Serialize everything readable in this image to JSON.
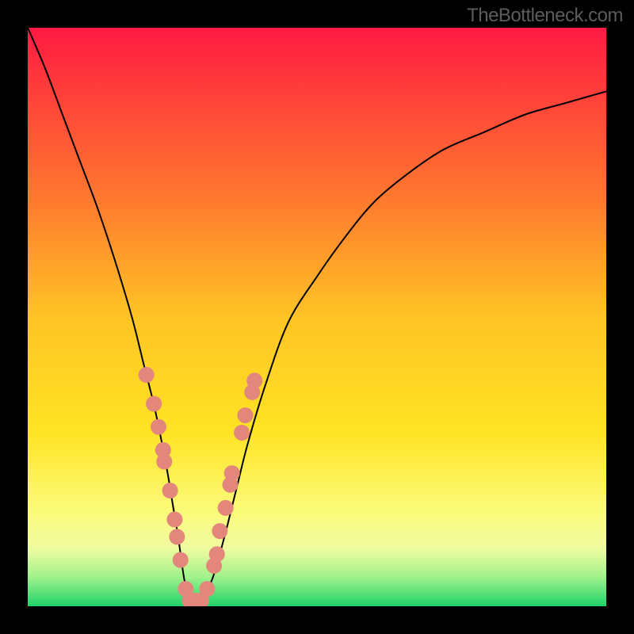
{
  "watermark": "TheBottleneck.com",
  "chart_data": {
    "type": "line",
    "title": "",
    "xlabel": "",
    "ylabel": "",
    "xlim": [
      0,
      100
    ],
    "ylim": [
      0,
      100
    ],
    "background_gradient": {
      "stops": [
        {
          "offset": 0.0,
          "color": "#ff1a42"
        },
        {
          "offset": 0.1,
          "color": "#ff3b3b"
        },
        {
          "offset": 0.3,
          "color": "#ff7a2e"
        },
        {
          "offset": 0.5,
          "color": "#ffc425"
        },
        {
          "offset": 0.7,
          "color": "#ffe424"
        },
        {
          "offset": 0.84,
          "color": "#fbfb7c"
        },
        {
          "offset": 0.9,
          "color": "#f0fba0"
        },
        {
          "offset": 0.95,
          "color": "#9ff28a"
        },
        {
          "offset": 1.0,
          "color": "#1fd36a"
        }
      ]
    },
    "series": [
      {
        "name": "bottleneck-curve",
        "color": "#000000",
        "x": [
          0,
          3,
          6,
          9,
          12,
          15,
          18,
          20,
          22,
          24,
          25,
          26,
          27,
          28,
          30,
          32,
          34,
          36,
          38,
          41,
          45,
          50,
          55,
          60,
          66,
          72,
          79,
          86,
          93,
          100
        ],
        "y": [
          100,
          93,
          85,
          77,
          69,
          60,
          50,
          42,
          34,
          24,
          18,
          12,
          5,
          1,
          1,
          5,
          12,
          20,
          28,
          38,
          49,
          57,
          64,
          70,
          75,
          79,
          82,
          85,
          87,
          89
        ]
      }
    ],
    "markers": {
      "name": "highlight-points",
      "color": "#e3877d",
      "radius": 10,
      "points": [
        {
          "x": 20.5,
          "y": 40
        },
        {
          "x": 21.8,
          "y": 35
        },
        {
          "x": 22.6,
          "y": 31
        },
        {
          "x": 23.4,
          "y": 27
        },
        {
          "x": 23.6,
          "y": 25
        },
        {
          "x": 24.6,
          "y": 20
        },
        {
          "x": 25.4,
          "y": 15
        },
        {
          "x": 25.8,
          "y": 12
        },
        {
          "x": 26.4,
          "y": 8
        },
        {
          "x": 27.3,
          "y": 3
        },
        {
          "x": 28.0,
          "y": 1
        },
        {
          "x": 29.0,
          "y": 1
        },
        {
          "x": 30.0,
          "y": 1
        },
        {
          "x": 31.0,
          "y": 3
        },
        {
          "x": 32.2,
          "y": 7
        },
        {
          "x": 32.7,
          "y": 9
        },
        {
          "x": 33.2,
          "y": 13
        },
        {
          "x": 34.2,
          "y": 17
        },
        {
          "x": 35.0,
          "y": 21
        },
        {
          "x": 35.3,
          "y": 23
        },
        {
          "x": 37.0,
          "y": 30
        },
        {
          "x": 37.6,
          "y": 33
        },
        {
          "x": 38.8,
          "y": 37
        },
        {
          "x": 39.2,
          "y": 39
        }
      ]
    }
  }
}
